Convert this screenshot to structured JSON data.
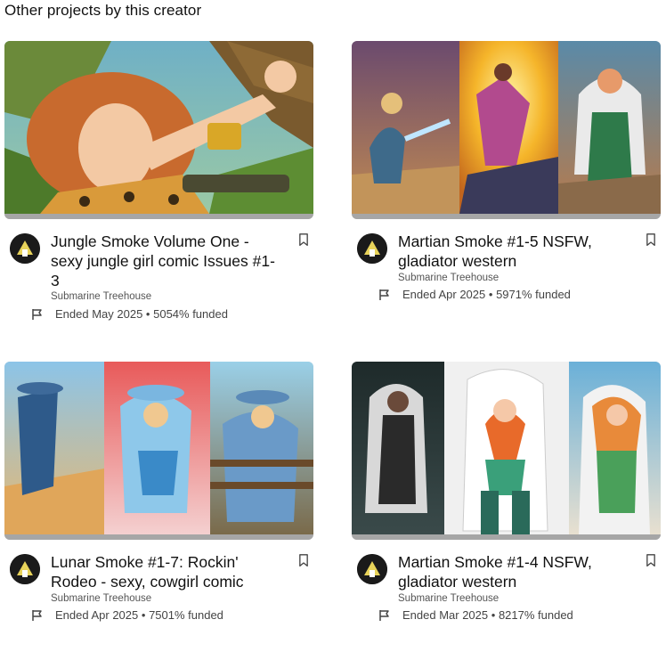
{
  "section": {
    "title": "Other projects by this creator"
  },
  "colors": {
    "progress_track": "#bdbdbd",
    "progress_fill": "#a6a6a6",
    "avatar_bg": "#1a1a1a",
    "avatar_accent": "#e8d35a"
  },
  "projects": [
    {
      "title": "Jungle Smoke Volume One - sexy jungle girl comic Issues #1-3",
      "creator": "Submarine Treehouse",
      "ended": "Ended May 2025",
      "separator": "•",
      "funded": "5054% funded",
      "image_desc": "jungle-girl-art",
      "progress": 1.0
    },
    {
      "title": "Martian Smoke #1-5 NSFW, gladiator western",
      "creator": "Submarine Treehouse",
      "ended": "Ended Apr 2025",
      "separator": "•",
      "funded": "5971% funded",
      "image_desc": "martian-triptych-art",
      "progress": 1.0
    },
    {
      "title": "Lunar Smoke #1-7: Rockin' Rodeo - sexy, cowgirl comic",
      "creator": "Submarine Treehouse",
      "ended": "Ended Apr 2025",
      "separator": "•",
      "funded": "7501% funded",
      "image_desc": "cowgirl-triptych-art",
      "progress": 1.0
    },
    {
      "title": "Martian Smoke #1-4 NSFW, gladiator western",
      "creator": "Submarine Treehouse",
      "ended": "Ended Mar 2025",
      "separator": "•",
      "funded": "8217% funded",
      "image_desc": "hooded-women-triptych-art",
      "progress": 1.0
    }
  ]
}
